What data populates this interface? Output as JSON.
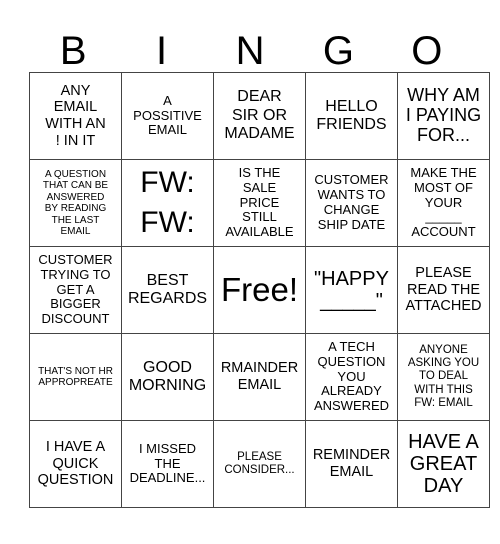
{
  "header": {
    "letters": [
      "B",
      "I",
      "N",
      "G",
      "O"
    ]
  },
  "board": {
    "rows": [
      [
        "ANY\nEMAIL\nWITH AN\n! IN IT",
        "A\nPOSSITIVE\nEMAIL",
        "DEAR\nSIR OR\nMADAME",
        "HELLO\nFRIENDS",
        "WHY AM\nI PAYING\nFOR..."
      ],
      [
        "A QUESTION\nTHAT CAN BE\nANSWERED\nBY READING\nTHE LAST\nEMAIL",
        "FW:\nFW:",
        "IS THE\nSALE\nPRICE\nSTILL\nAVAILABLE",
        "CUSTOMER\nWANTS TO\nCHANGE\nSHIP DATE",
        "MAKE THE\nMOST OF\nYOUR\n_____\nACCOUNT"
      ],
      [
        "CUSTOMER\nTRYING TO\nGET A\nBIGGER\nDISCOUNT",
        "BEST\nREGARDS",
        "Free!",
        "\"HAPPY\n_____\"",
        "PLEASE\nREAD THE\nATTACHED"
      ],
      [
        "THAT'S NOT HR\nAPPROPREATE",
        "GOOD\nMORNING",
        "RMAINDER\nEMAIL",
        "A TECH\nQUESTION\nYOU\nALREADY\nANSWERED",
        "ANYONE\nASKING YOU\nTO DEAL\nWITH THIS\nFW: EMAIL"
      ],
      [
        "I HAVE A\nQUICK\nQUESTION",
        "I MISSED\nTHE\nDEADLINE...",
        "PLEASE\nCONSIDER...",
        "REMINDER\nEMAIL",
        "HAVE A\nGREAT\nDAY"
      ]
    ]
  }
}
